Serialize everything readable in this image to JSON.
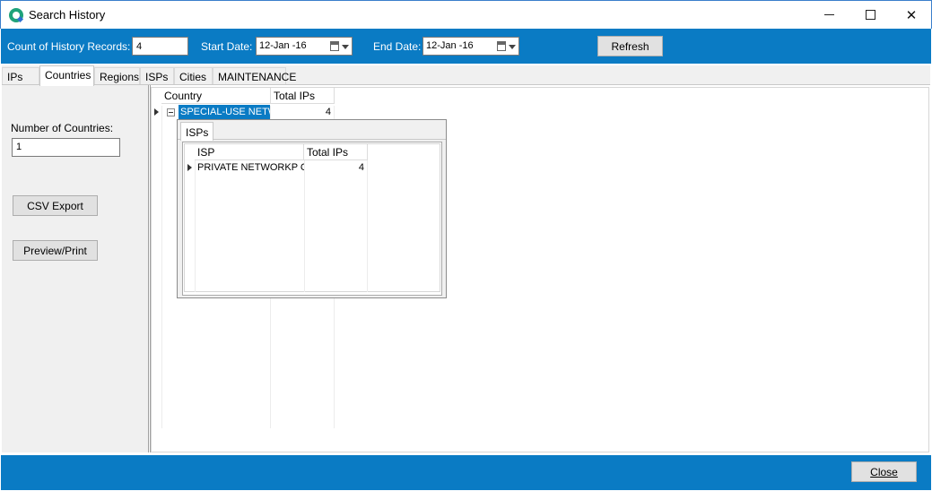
{
  "window": {
    "title": "Search History"
  },
  "toolbar": {
    "count_label": "Count of History Records:",
    "count_value": "4",
    "start_label": "Start Date:",
    "start_value": "12-Jan -16",
    "end_label": "End Date:",
    "end_value": "12-Jan -16",
    "refresh_label": "Refresh"
  },
  "tabs": [
    {
      "label": "IPs"
    },
    {
      "label": "Countries"
    },
    {
      "label": "Regions"
    },
    {
      "label": "ISPs"
    },
    {
      "label": "Cities"
    },
    {
      "label": "MAINTENANCE"
    }
  ],
  "active_tab": "Countries",
  "left_panel": {
    "num_countries_label": "Number of Countries:",
    "num_countries_value": "1",
    "csv_export_label": "CSV Export",
    "preview_print_label": "Preview/Print"
  },
  "country_grid": {
    "columns": [
      "Country",
      "Total IPs"
    ],
    "rows": [
      {
        "country": "SPECIAL-USE NETWC",
        "total_ips": "4"
      }
    ]
  },
  "detail": {
    "tab_label": "ISPs",
    "columns": [
      "ISP",
      "Total IPs"
    ],
    "rows": [
      {
        "isp": "PRIVATE NETWORKP CL",
        "total_ips": "4"
      }
    ]
  },
  "footer": {
    "close_label": "Close"
  },
  "colors": {
    "accent": "#0a7bc4",
    "selection": "#0a7bc4"
  }
}
